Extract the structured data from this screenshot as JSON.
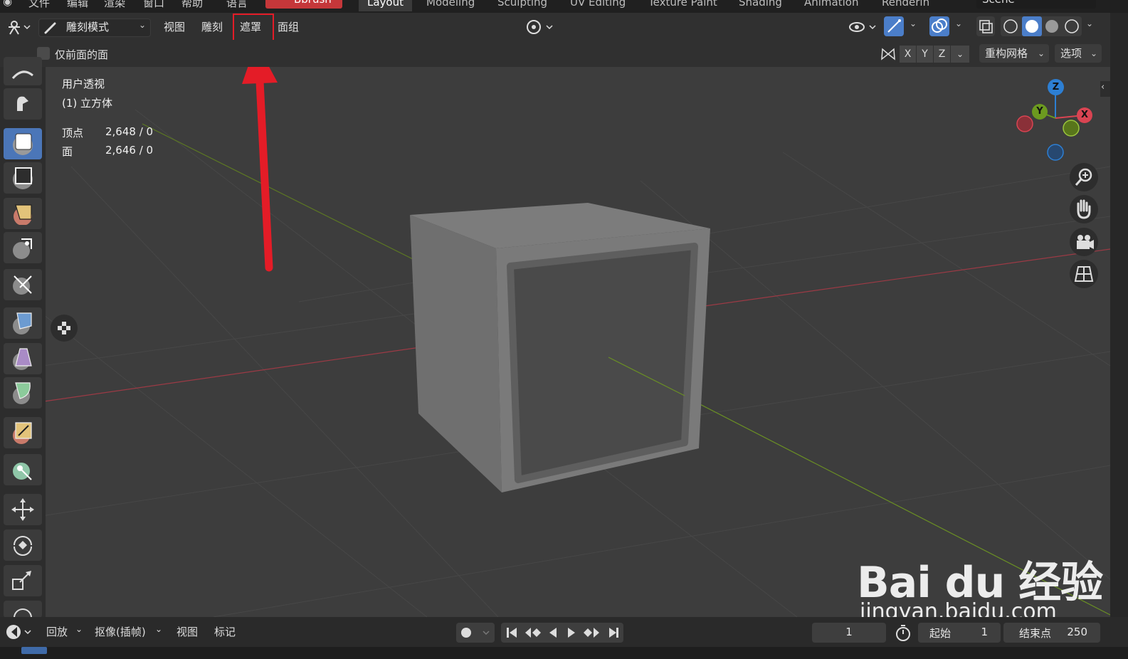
{
  "menubar": {
    "items": [
      "文件",
      "编辑",
      "渲染",
      "窗口",
      "帮助",
      "语言"
    ],
    "brush": "Bbrush",
    "workspaces": [
      "Layout",
      "Modeling",
      "Sculpting",
      "UV Editing",
      "Texture Paint",
      "Shading",
      "Animation",
      "Renderin"
    ],
    "active_workspace": "Layout",
    "scene": "Scene"
  },
  "header": {
    "mode": "雕刻模式",
    "menus": {
      "view": "视图",
      "sculpt": "雕刻",
      "mask": "遮罩",
      "face_sets": "面组"
    }
  },
  "subheader": {
    "front_faces_only": "仅前面的面",
    "axes": [
      "X",
      "Y",
      "Z"
    ],
    "remesh": "重构网格",
    "options": "选项"
  },
  "viewport_info": {
    "view": "用户透视",
    "object": "(1) 立方体",
    "vertices_label": "顶点",
    "vertices_value": "2,648 / 0",
    "faces_label": "面",
    "faces_value": "2,646 / 0"
  },
  "gizmo": {
    "z": "Z",
    "y": "Y",
    "x": "X"
  },
  "timeline": {
    "playback": "回放",
    "keying": "抠像(插帧)",
    "view": "视图",
    "marker": "标记",
    "current_frame": "1",
    "start_label": "起始",
    "start_value": "1",
    "end_label": "结束点",
    "end_value": "250"
  },
  "watermark": {
    "brand": "Bai du 经验",
    "url": "jingyan.baidu.com"
  },
  "colors": {
    "accent_blue": "#4b7ec9",
    "annotation_red": "#e41c27",
    "brush_red": "#c5373a",
    "axis_x": "#d94452",
    "axis_y": "#6c9a1f",
    "axis_z": "#2d7fd3"
  }
}
